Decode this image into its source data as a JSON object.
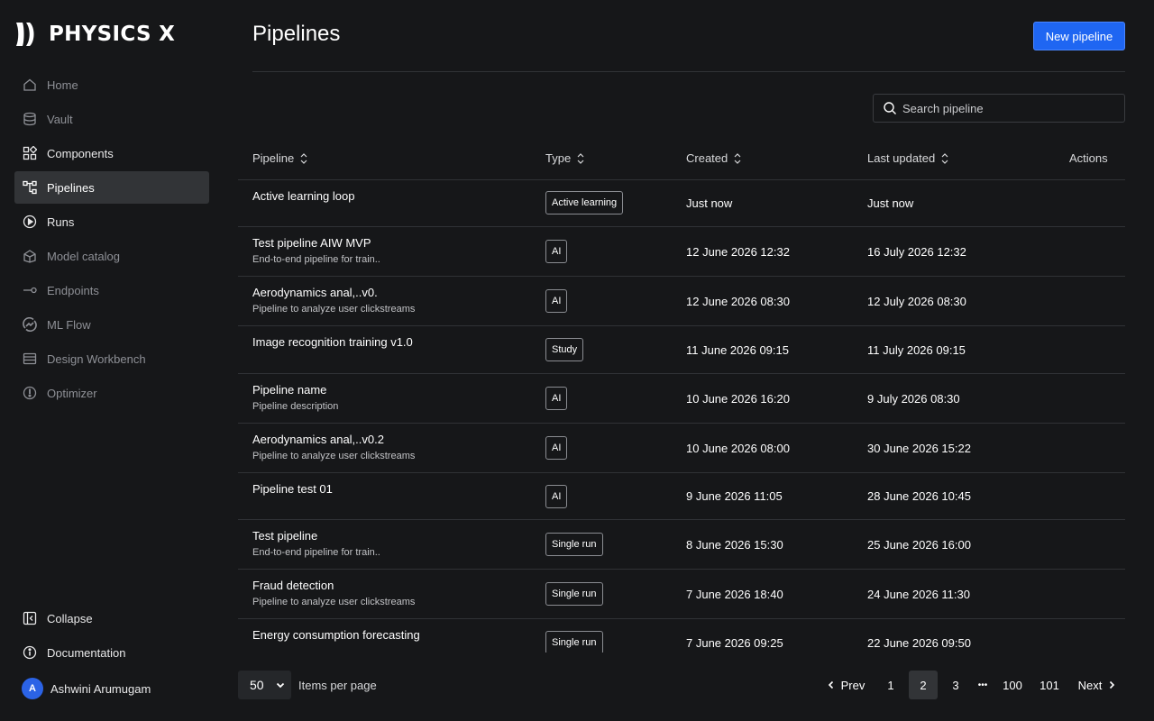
{
  "brand": {
    "name": "PHYSICS X",
    "logo_icon": "physicsx-logo-icon"
  },
  "sidebar": {
    "items": [
      {
        "label": "Home",
        "icon": "home-icon",
        "state": "dim"
      },
      {
        "label": "Vault",
        "icon": "database-icon",
        "state": "dim"
      },
      {
        "label": "Components",
        "icon": "grid-icon",
        "state": "bright"
      },
      {
        "label": "Pipelines",
        "icon": "pipeline-icon",
        "state": "active"
      },
      {
        "label": "Runs",
        "icon": "play-icon",
        "state": "bright"
      },
      {
        "label": "Model catalog",
        "icon": "catalog-icon",
        "state": "dim"
      },
      {
        "label": "Endpoints",
        "icon": "endpoint-icon",
        "state": "dim"
      },
      {
        "label": "ML Flow",
        "icon": "mlflow-icon",
        "state": "dim"
      },
      {
        "label": "Design Workbench",
        "icon": "workbench-icon",
        "state": "dim"
      },
      {
        "label": "Optimizer",
        "icon": "optimizer-icon",
        "state": "dim"
      }
    ],
    "bottom": [
      {
        "label": "Collapse",
        "icon": "collapse-icon"
      },
      {
        "label": "Documentation",
        "icon": "info-icon"
      }
    ],
    "user": {
      "initial": "A",
      "name": "Ashwini Arumugam"
    }
  },
  "header": {
    "title": "Pipelines",
    "new_button": "New pipeline"
  },
  "search": {
    "placeholder": "Search pipeline"
  },
  "table": {
    "columns": {
      "pipeline": "Pipeline",
      "type": "Type",
      "created": "Created",
      "updated": "Last updated",
      "actions": "Actions"
    },
    "rows": [
      {
        "name": "Active learning loop",
        "desc": "",
        "type": "Active learning",
        "created": "Just now",
        "updated": "Just now"
      },
      {
        "name": "Test pipeline AIW MVP",
        "desc": "End-to-end pipeline for train..",
        "type": "AI",
        "created": "12 June 2026 12:32",
        "updated": "16 July 2026 12:32"
      },
      {
        "name": "Aerodynamics anal,..v0.",
        "desc": "Pipeline to analyze user clickstreams",
        "type": "AI",
        "created": "12 June 2026 08:30",
        "updated": "12 July 2026 08:30"
      },
      {
        "name": "Image recognition training v1.0",
        "desc": "",
        "type": "Study",
        "created": "11 June 2026 09:15",
        "updated": "11 July 2026 09:15"
      },
      {
        "name": "Pipeline name",
        "desc": "Pipeline description",
        "type": "AI",
        "created": "10 June 2026 16:20",
        "updated": "9 July 2026 08:30"
      },
      {
        "name": "Aerodynamics anal,..v0.2",
        "desc": "Pipeline to analyze user clickstreams",
        "type": "AI",
        "created": "10 June 2026 08:00",
        "updated": "30 June 2026 15:22"
      },
      {
        "name": "Pipeline test 01",
        "desc": "",
        "type": "AI",
        "created": "9 June 2026 11:05",
        "updated": "28 June 2026 10:45"
      },
      {
        "name": "Test pipeline",
        "desc": "End-to-end pipeline for train..",
        "type": "Single run",
        "created": "8 June 2026 15:30",
        "updated": "25 June 2026 16:00"
      },
      {
        "name": "Fraud detection",
        "desc": "Pipeline to analyze user clickstreams",
        "type": "Single run",
        "created": "7 June 2026 18:40",
        "updated": "24 June 2026 11:30"
      },
      {
        "name": "Energy consumption forecasting",
        "desc": "",
        "type": "Single run",
        "created": "7 June 2026 09:25",
        "updated": "22 June 2026 09:50"
      }
    ]
  },
  "footer": {
    "per_page_value": "50",
    "per_page_label": "Items per page",
    "prev": "Prev",
    "next": "Next",
    "pages": [
      "1",
      "2",
      "3",
      "•••",
      "100",
      "101"
    ],
    "current_page": "2"
  }
}
